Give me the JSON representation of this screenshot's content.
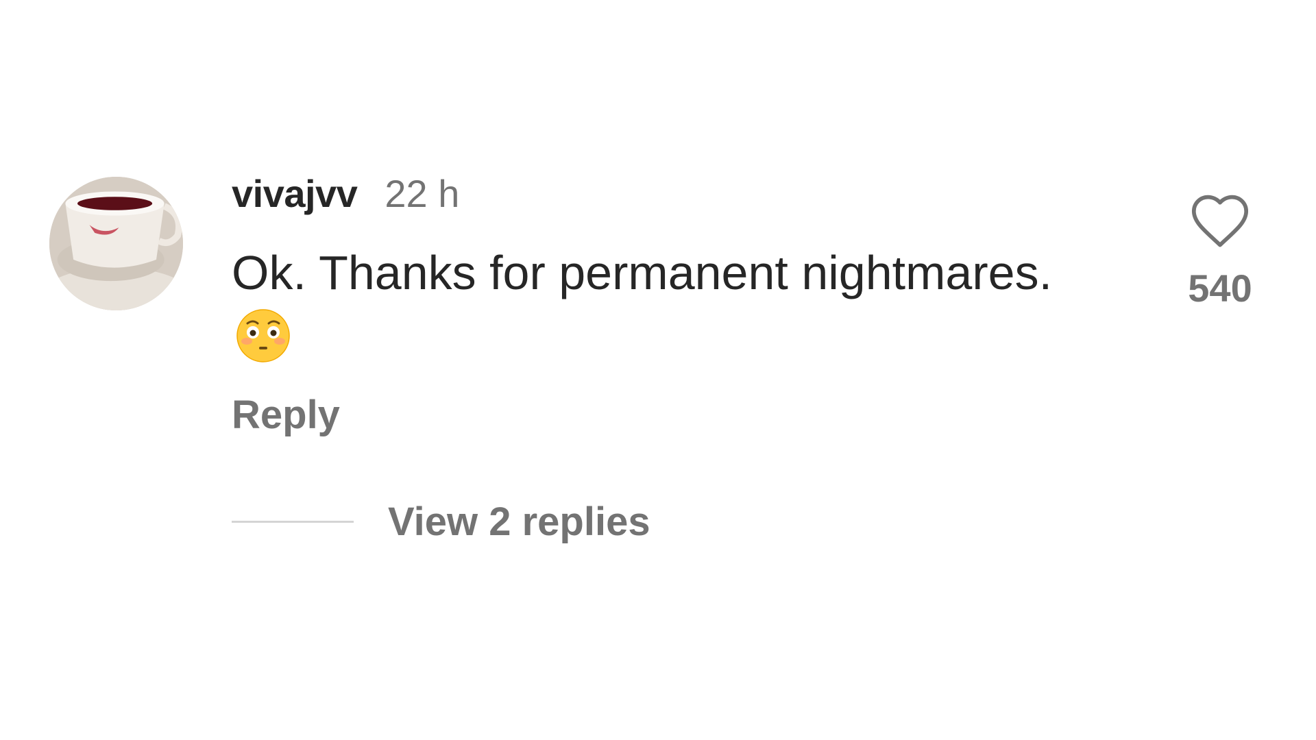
{
  "comment": {
    "username": "vivajvv",
    "timestamp": "22 h",
    "text": "Ok. Thanks for permanent nightmares.",
    "emoji": "flushed-face",
    "reply_label": "Reply",
    "view_replies_label": "View 2 replies",
    "like_count": "540"
  },
  "colors": {
    "primary_text": "#262626",
    "secondary_text": "#737373",
    "divider": "#d4d4d4",
    "background": "#ffffff"
  },
  "icons": {
    "like": "heart-outline-icon",
    "emoji": "flushed-face-emoji"
  }
}
